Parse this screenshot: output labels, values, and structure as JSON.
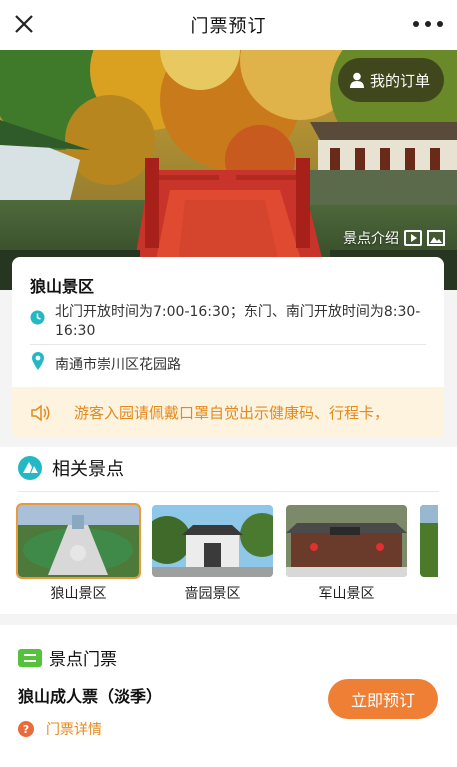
{
  "topbar": {
    "title": "门票预订"
  },
  "hero": {
    "my_orders": "我的订单",
    "intro": "景点介绍"
  },
  "scenic": {
    "name": "狼山景区",
    "hours": "北门开放时间为7:00-16:30；东门、南门开放时间为8:30-16:30",
    "address": "南通市崇川区花园路",
    "notice": "游客入园请佩戴口罩自觉出示健康码、行程卡，"
  },
  "related": {
    "title": "相关景点",
    "spots": [
      {
        "label": "狼山景区"
      },
      {
        "label": "啬园景区"
      },
      {
        "label": "军山景区"
      }
    ]
  },
  "tickets": {
    "title": "景点门票",
    "product": "狼山成人票（淡季）",
    "detail": "门票详情",
    "book": "立即预订",
    "detail_icon": "?"
  },
  "colors": {
    "accent": "#ee7f35",
    "notice_bg": "#fdf3df",
    "teal": "#22b9c4",
    "green": "#56c23b"
  }
}
